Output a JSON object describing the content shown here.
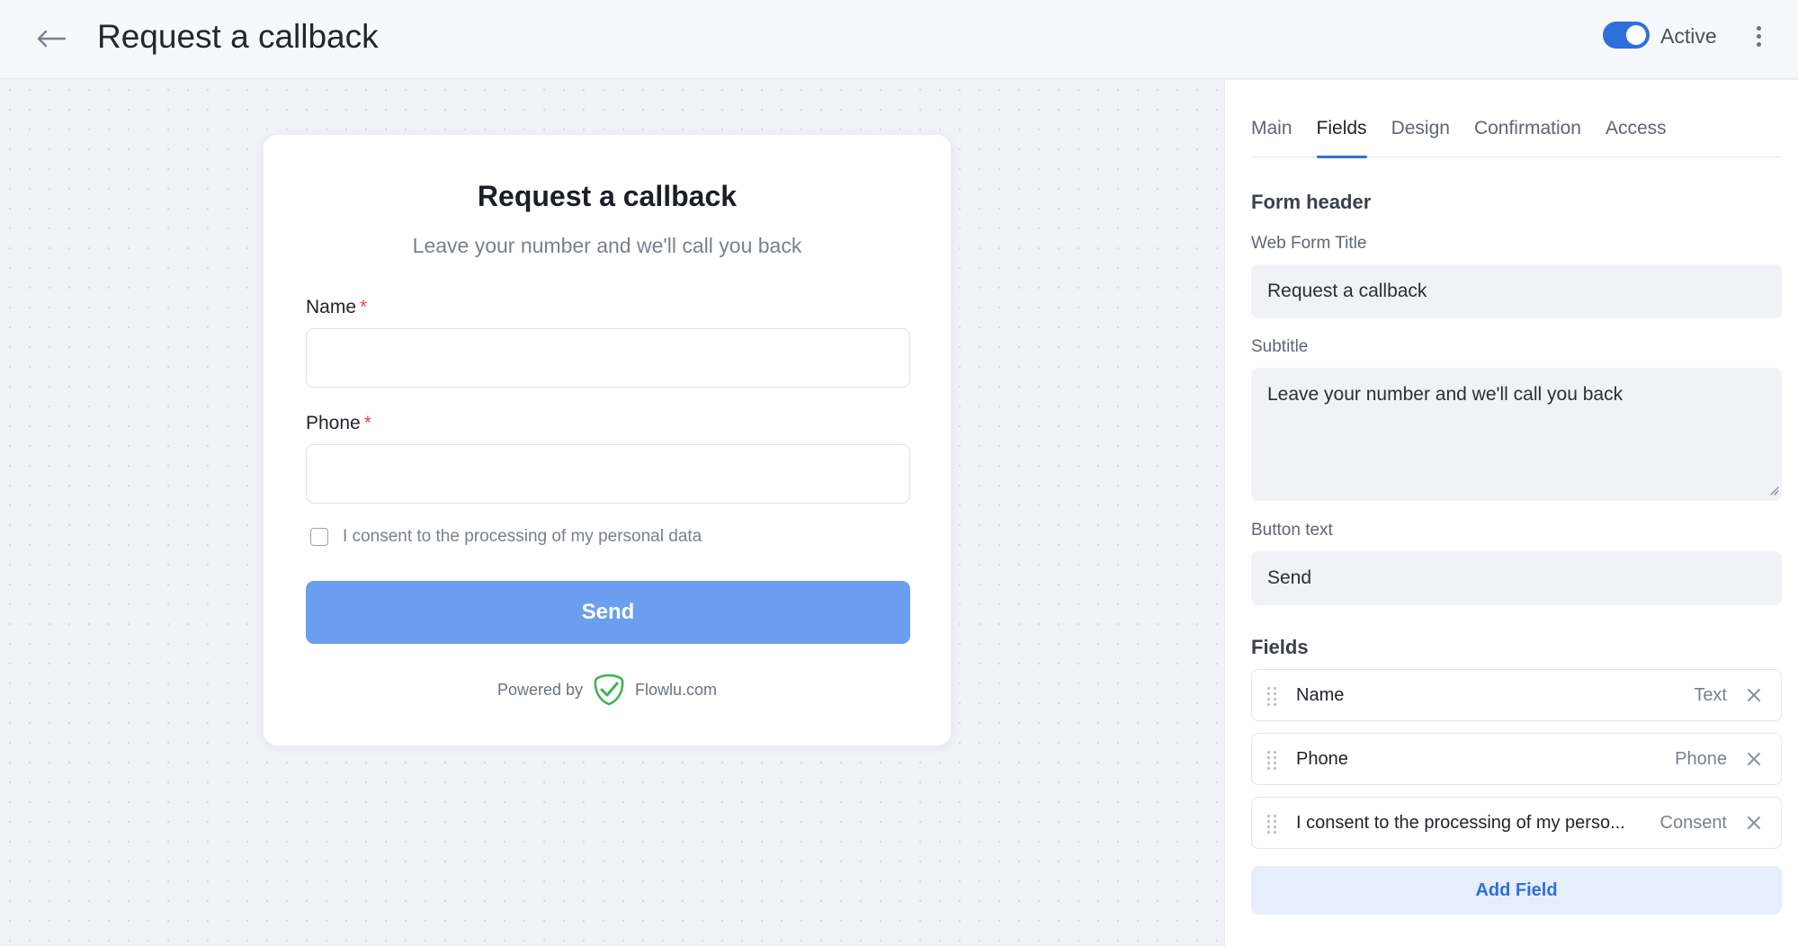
{
  "header": {
    "title": "Request a callback",
    "status_label": "Active",
    "status_active": true
  },
  "form_preview": {
    "title": "Request a callback",
    "subtitle": "Leave your number and we'll call you back",
    "fields": [
      {
        "label": "Name",
        "required_mark": "*",
        "value": ""
      },
      {
        "label": "Phone",
        "required_mark": "*",
        "value": ""
      }
    ],
    "consent_label": "I consent to the processing of my personal data",
    "consent_checked": false,
    "button_label": "Send",
    "powered_by_label": "Powered by",
    "brand_name": "Flowlu.com"
  },
  "panel": {
    "tabs": [
      {
        "label": "Main",
        "active": false
      },
      {
        "label": "Fields",
        "active": true
      },
      {
        "label": "Design",
        "active": false
      },
      {
        "label": "Confirmation",
        "active": false
      },
      {
        "label": "Access",
        "active": false
      }
    ],
    "form_header_title": "Form header",
    "web_form_title_label": "Web Form Title",
    "web_form_title_value": "Request a callback",
    "subtitle_label": "Subtitle",
    "subtitle_value": "Leave your number and we'll call you back",
    "button_text_label": "Button text",
    "button_text_value": "Send",
    "fields_title": "Fields",
    "fields": [
      {
        "name": "Name",
        "type": "Text"
      },
      {
        "name": "Phone",
        "type": "Phone"
      },
      {
        "name": "I consent to the processing of my perso...",
        "type": "Consent"
      }
    ],
    "add_field_label": "Add Field"
  },
  "colors": {
    "accent": "#2f6fdc",
    "send_button": "#6a9ff0",
    "required": "#e5484d",
    "brand_check": "#3fb34f"
  },
  "icons": {
    "back": "arrow-left-icon",
    "menu": "more-vertical-icon",
    "drag": "drag-handle-icon",
    "remove": "close-icon",
    "brand": "flowlu-check-shield-icon"
  }
}
